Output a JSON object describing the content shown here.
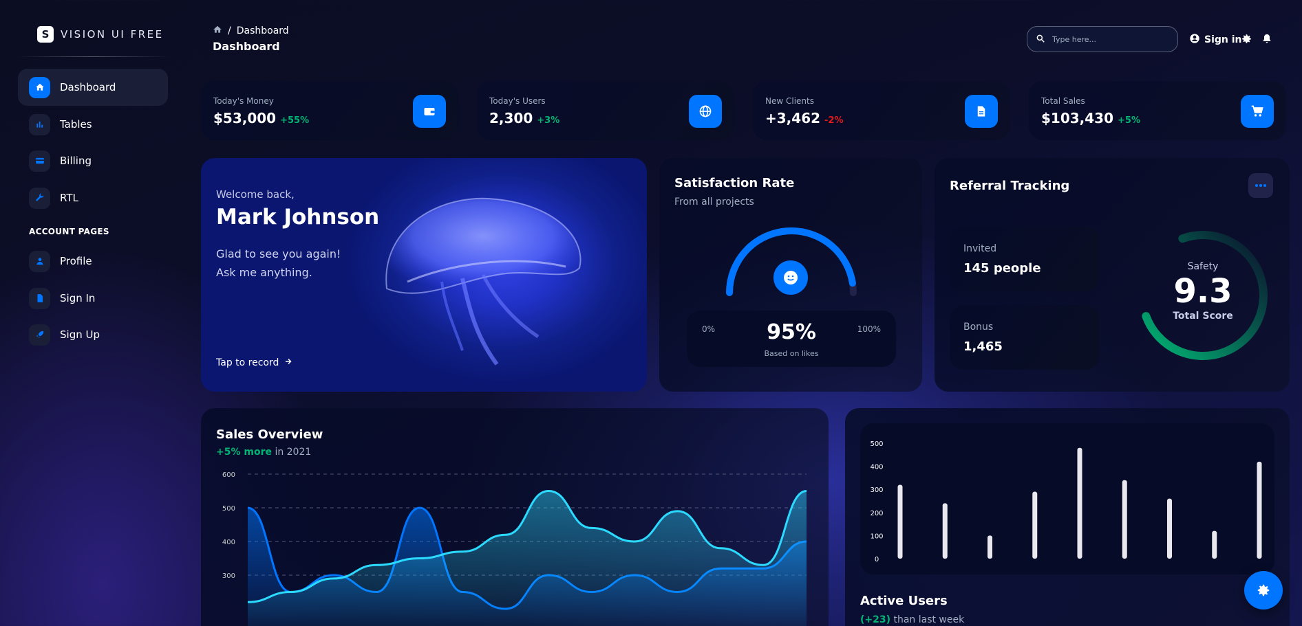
{
  "brand": {
    "name": "VISION UI FREE",
    "logo_letter": "S"
  },
  "sidebar": {
    "items": [
      {
        "label": "Dashboard",
        "icon": "home-icon",
        "active": true
      },
      {
        "label": "Tables",
        "icon": "chart-icon"
      },
      {
        "label": "Billing",
        "icon": "credit-card-icon"
      },
      {
        "label": "RTL",
        "icon": "wrench-icon"
      }
    ],
    "section_title": "ACCOUNT PAGES",
    "account_items": [
      {
        "label": "Profile",
        "icon": "person-icon"
      },
      {
        "label": "Sign In",
        "icon": "document-icon"
      },
      {
        "label": "Sign Up",
        "icon": "rocket-icon"
      }
    ]
  },
  "header": {
    "breadcrumb_current": "Dashboard",
    "page_title": "Dashboard",
    "search_placeholder": "Type here...",
    "signin_label": "Sign in"
  },
  "stats": [
    {
      "label": "Today's Money",
      "value": "$53,000",
      "change": "+55%",
      "change_color": "#01b574",
      "icon": "wallet-icon"
    },
    {
      "label": "Today's Users",
      "value": "2,300",
      "change": "+3%",
      "change_color": "#01b574",
      "icon": "globe-icon"
    },
    {
      "label": "New Clients",
      "value": "+3,462",
      "change": "-2%",
      "change_color": "#e31a1a",
      "icon": "document-icon"
    },
    {
      "label": "Total Sales",
      "value": "$103,430",
      "change": "+5%",
      "change_color": "#01b574",
      "icon": "cart-icon"
    }
  ],
  "welcome": {
    "greeting": "Welcome back,",
    "name": "Mark Johnson",
    "message_line1": "Glad to see you again!",
    "message_line2": "Ask me anything.",
    "cta": "Tap to record"
  },
  "satisfaction": {
    "title": "Satisfaction Rate",
    "subtitle": "From all projects",
    "min_label": "0%",
    "max_label": "100%",
    "value": "95%",
    "value_fraction": 0.95,
    "caption": "Based on likes"
  },
  "referral": {
    "title": "Referral Tracking",
    "invited_label": "Invited",
    "invited_value": "145 people",
    "bonus_label": "Bonus",
    "bonus_value": "1,465",
    "safety_label": "Safety",
    "score": "9.3",
    "score_label": "Total Score",
    "score_fraction": 0.93
  },
  "sales": {
    "title": "Sales Overview",
    "change": "+5% more",
    "period": "in 2021"
  },
  "active_users": {
    "title": "Active Users",
    "change": "(+23)",
    "suffix": "than last week"
  },
  "chart_data": [
    {
      "type": "area",
      "ylim": [
        0,
        600
      ],
      "yticks": [
        300,
        400,
        500,
        600
      ],
      "series": [
        {
          "values": [
            500,
            250,
            300,
            250,
            500,
            250,
            200,
            300,
            250,
            300,
            250,
            320,
            320,
            400
          ]
        },
        {
          "values": [
            220,
            250,
            290,
            330,
            350,
            370,
            420,
            550,
            440,
            400,
            490,
            380,
            330,
            550
          ]
        }
      ]
    },
    {
      "type": "bar",
      "ylim": [
        0,
        500
      ],
      "yticks": [
        0,
        100,
        200,
        300,
        400,
        500
      ],
      "values": [
        320,
        240,
        100,
        290,
        480,
        340,
        260,
        120,
        420
      ]
    }
  ],
  "colors": {
    "accent": "#0075ff",
    "positive": "#01b574",
    "negative": "#e31a1a",
    "gauge": "#01b574"
  }
}
